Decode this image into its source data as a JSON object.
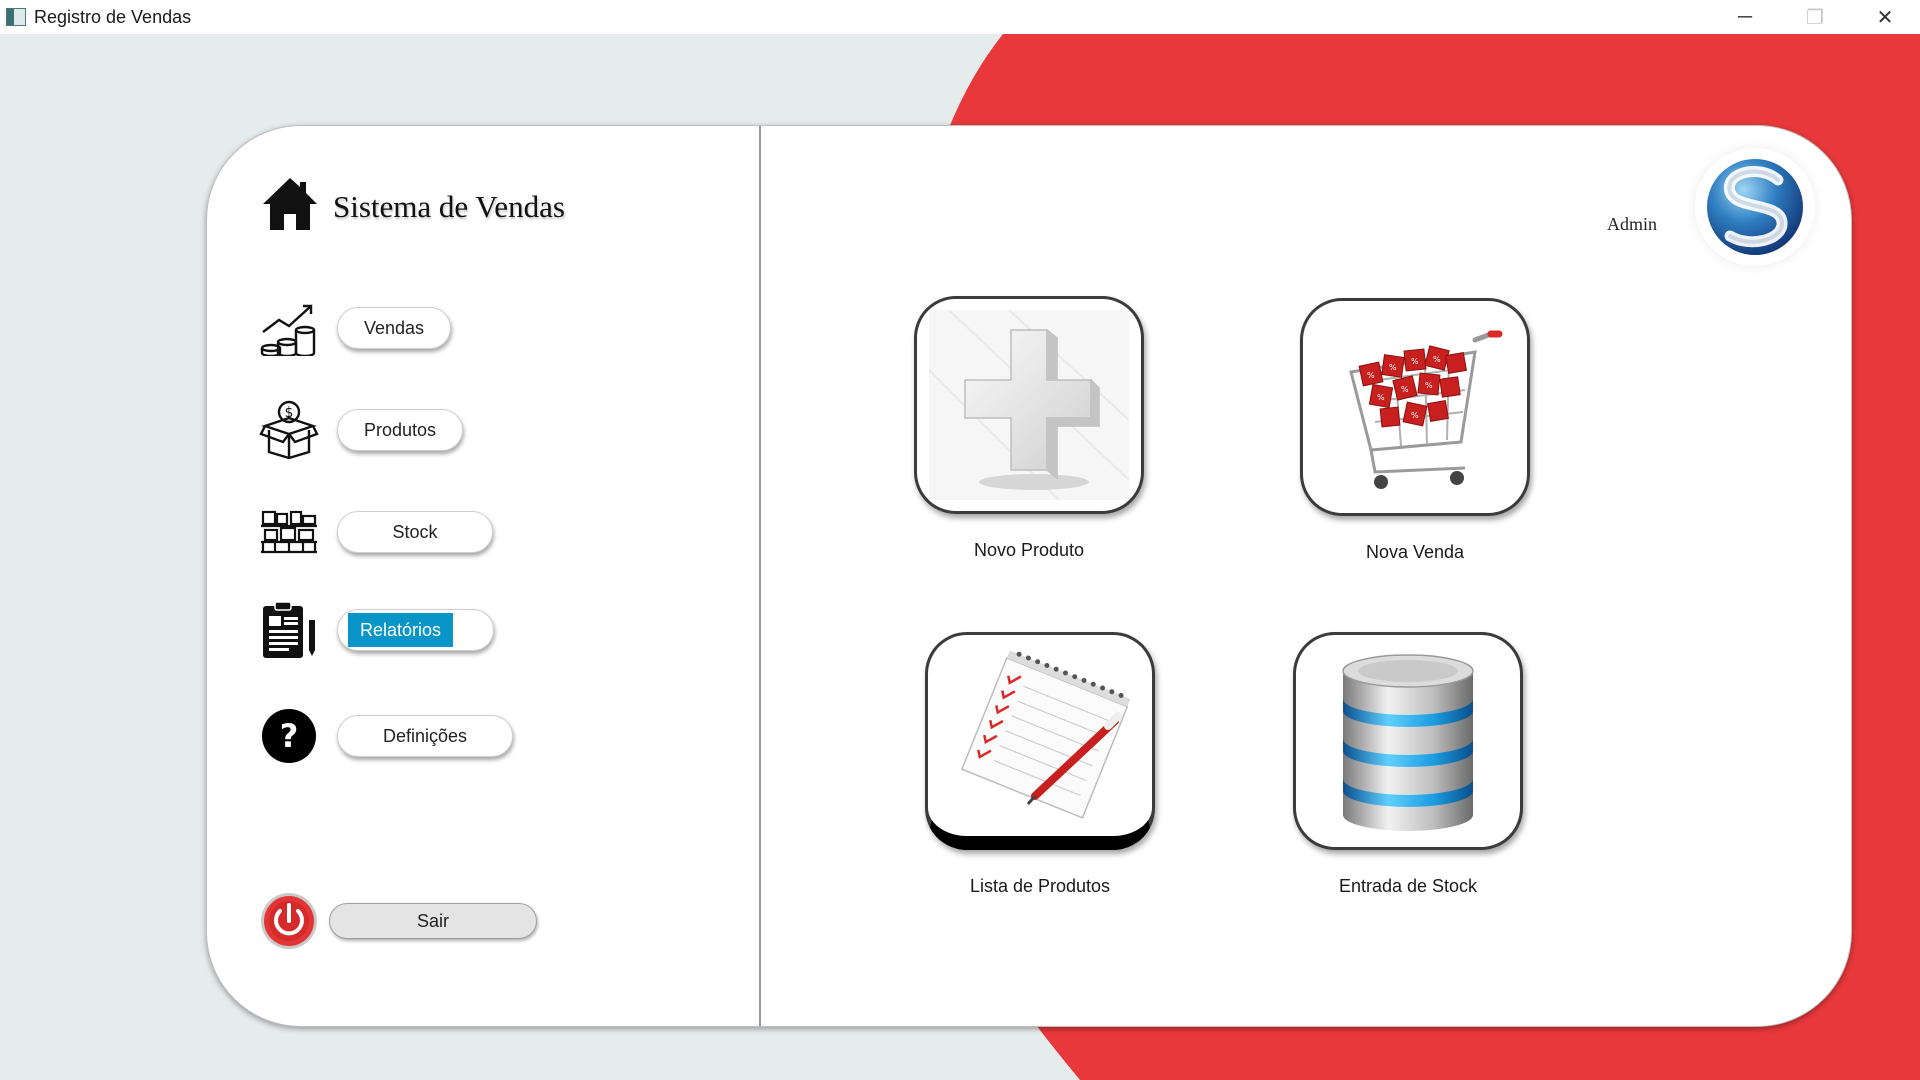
{
  "window": {
    "title": "Registro de Vendas",
    "controls": {
      "minimize": "─",
      "restore": "❐",
      "close": "✕"
    }
  },
  "colors": {
    "accent_red": "#e8383b",
    "active_blue": "#0a95c8",
    "background": "#e6ebeb"
  },
  "sidebar": {
    "title": "Sistema de Vendas",
    "items": [
      {
        "label": "Vendas",
        "icon": "sales-chart-coins-icon"
      },
      {
        "label": "Produtos",
        "icon": "money-box-icon"
      },
      {
        "label": "Stock",
        "icon": "warehouse-boxes-icon"
      },
      {
        "label": "Relatórios",
        "icon": "clipboard-report-icon",
        "active": true
      },
      {
        "label": "Definições",
        "icon": "question-circle-icon"
      }
    ],
    "exit_label": "Sair"
  },
  "user": {
    "name": "Admin",
    "logo_icon": "s-sphere-logo"
  },
  "tiles": [
    {
      "label": "Novo Produto",
      "icon": "plus-cross-icon"
    },
    {
      "label": "Nova Venda",
      "icon": "shopping-cart-icon"
    },
    {
      "label": "Lista de Produtos",
      "icon": "notepad-checklist-icon"
    },
    {
      "label": "Entrada de Stock",
      "icon": "database-icon"
    }
  ]
}
